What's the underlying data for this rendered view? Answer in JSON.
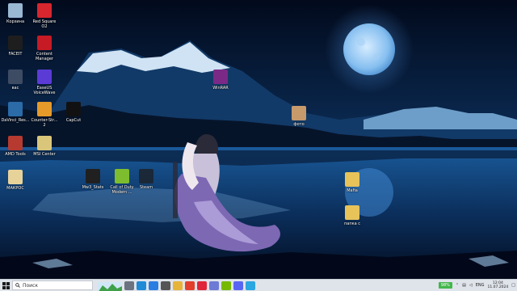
{
  "desktop_icons": [
    {
      "label": "Корзина",
      "icon": "recycle-bin-icon",
      "color": "#9bb8d3"
    },
    {
      "label": "Red Square\nO2",
      "icon": "red-square-icon",
      "color": "#d7262e"
    },
    {
      "label": "FACEIT",
      "icon": "faceit-icon",
      "color": "#1e1e1e"
    },
    {
      "label": "Content\nManager",
      "icon": "content-manager-icon",
      "color": "#c61b24"
    },
    {
      "label": "вас",
      "icon": "folder-icon",
      "color": "#3d4b63"
    },
    {
      "label": "EaseUS\nVoiceWave",
      "icon": "easeus-voicewave-icon",
      "color": "#5b3bd6"
    },
    {
      "label": "DaVinci_Res...",
      "icon": "davinci-resolve-icon",
      "color": "#2a6ba8"
    },
    {
      "label": "Counter-Str...\n2",
      "icon": "counter-strike-icon",
      "color": "#e69a2a"
    },
    {
      "label": "CapCut",
      "icon": "capcut-icon",
      "color": "#111111"
    },
    {
      "label": "AMD Tools",
      "icon": "amd-tools-icon",
      "color": "#b63a2f"
    },
    {
      "label": "MSI Center",
      "icon": "msi-center-icon",
      "color": "#d9c67a"
    },
    {
      "label": "МАКРОС",
      "icon": "document-icon",
      "color": "#e7d39a"
    },
    {
      "label": "Mw3_Stats",
      "icon": "mw3-stats-icon",
      "color": "#202020"
    },
    {
      "label": "Call of Duty\nModern ...",
      "icon": "call-of-duty-icon",
      "color": "#7dbd2e"
    },
    {
      "label": "Steam",
      "icon": "steam-icon",
      "color": "#1b2838"
    },
    {
      "label": "WinRAR",
      "icon": "winrar-icon",
      "color": "#7a2a86"
    },
    {
      "label": "фото",
      "icon": "photo-icon",
      "color": "#c69a6a"
    },
    {
      "label": "Mafia",
      "icon": "folder-icon",
      "color": "#e7c35a"
    },
    {
      "label": "папка с",
      "icon": "folder-icon",
      "color": "#e7c35a"
    }
  ],
  "taskbar": {
    "search_placeholder": "Поиск",
    "apps": [
      {
        "icon": "task-view-icon",
        "color": "#6b7280"
      },
      {
        "icon": "edge-icon",
        "color": "#1f8ad6"
      },
      {
        "icon": "mail-icon",
        "color": "#2a7de1"
      },
      {
        "icon": "camera-icon",
        "color": "#555555"
      },
      {
        "icon": "file-explorer-icon",
        "color": "#e8b339"
      },
      {
        "icon": "yandex-browser-icon",
        "color": "#e33d2b"
      },
      {
        "icon": "opera-icon",
        "color": "#e0263a"
      },
      {
        "icon": "store-icon",
        "color": "#6d7bd4"
      },
      {
        "icon": "nvidia-icon",
        "color": "#76b900"
      },
      {
        "icon": "discord-icon",
        "color": "#5865f2"
      },
      {
        "icon": "telegram-icon",
        "color": "#2aa6e0"
      }
    ],
    "battery": "98%",
    "language": "ENG",
    "time": "12:04",
    "date": "11.07.2024"
  }
}
